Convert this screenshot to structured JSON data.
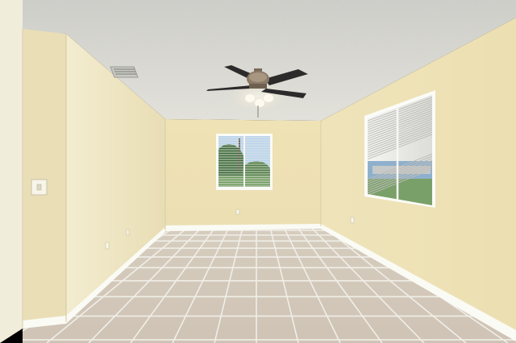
{
  "scene": {
    "subject": "empty-room",
    "palette": {
      "ceiling": "#d8d8d2",
      "wall_left": "#efe6c4",
      "wall_back": "#f0e3b7",
      "wall_right": "#eee2b5",
      "floor_tile": "#d9cfc2",
      "grout": "#eeeeea",
      "baseboard": "#fbfbf6",
      "fan_blade": "#2c2a2a",
      "fan_motor": "#8a7a66",
      "light_glow": "#fff9e6",
      "sky": "#b9d6ee",
      "foliage": "#3d6b3a"
    }
  },
  "icons": {
    "ceiling_fan": "ceiling-fan-icon",
    "vent": "air-vent-icon",
    "switch": "light-switch-icon",
    "outlet": "wall-outlet-icon"
  }
}
